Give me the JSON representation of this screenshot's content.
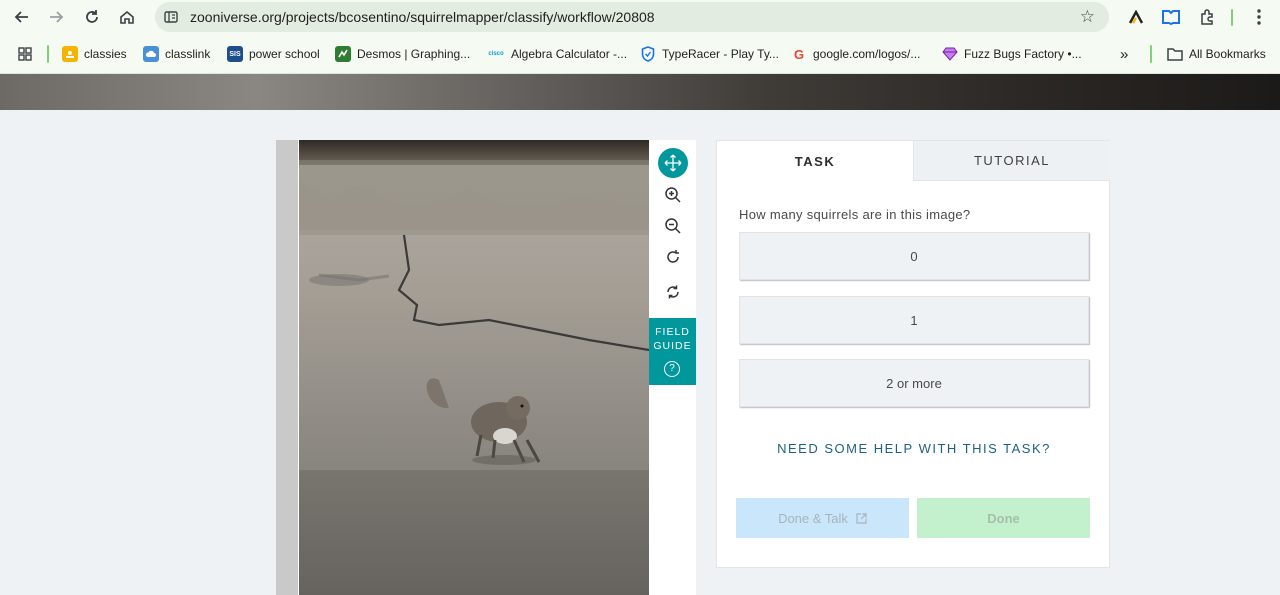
{
  "browser": {
    "url": "zooniverse.org/projects/bcosentino/squirrelmapper/classify/workflow/20808",
    "nav_icons": [
      "back-icon",
      "forward-icon",
      "reload-icon",
      "home-icon"
    ],
    "bookmarks": [
      {
        "label": "classies",
        "icon": "classroom-icon",
        "color": "#f4b400"
      },
      {
        "label": "classlink",
        "icon": "cloud-icon",
        "color": "#4a90d9"
      },
      {
        "label": "power school",
        "icon": "sis-icon",
        "icon_text": "SIS",
        "color": "#1f4e8c"
      },
      {
        "label": "Desmos | Graphing...",
        "icon": "desmos-icon",
        "color": "#2e7d32"
      },
      {
        "label": "Algebra Calculator -...",
        "icon": "cisco-icon",
        "icon_text": "cisco",
        "color": "#049fd9"
      },
      {
        "label": "TypeRacer - Play Ty...",
        "icon": "shield-icon",
        "color": "#1a73e8"
      },
      {
        "label": "google.com/logos/...",
        "icon": "google-icon",
        "icon_text": "G",
        "color": "#ea4335"
      },
      {
        "label": "Fuzz Bugs Factory •...",
        "icon": "gem-icon",
        "color": "#9c27b0"
      }
    ],
    "more_bookmarks": "»",
    "all_bookmarks": "All Bookmarks"
  },
  "viewer": {
    "tools": [
      "move-icon",
      "zoom-in-icon",
      "zoom-out-icon",
      "rotate-icon",
      "reset-icon"
    ],
    "field_guide_line1": "FIELD",
    "field_guide_line2": "GUIDE",
    "field_guide_help": "?"
  },
  "task": {
    "tabs": {
      "task": "TASK",
      "tutorial": "TUTORIAL"
    },
    "question": "How many squirrels are in this image?",
    "answers": [
      "0",
      "1",
      "2 or more"
    ],
    "help_link": "NEED SOME HELP WITH THIS TASK?",
    "done_talk": "Done & Talk",
    "done": "Done"
  },
  "colors": {
    "teal": "#00979d",
    "link": "#1e5f86",
    "done_talk_bg": "#c9e6fb",
    "done_bg": "#c3f0cd"
  }
}
